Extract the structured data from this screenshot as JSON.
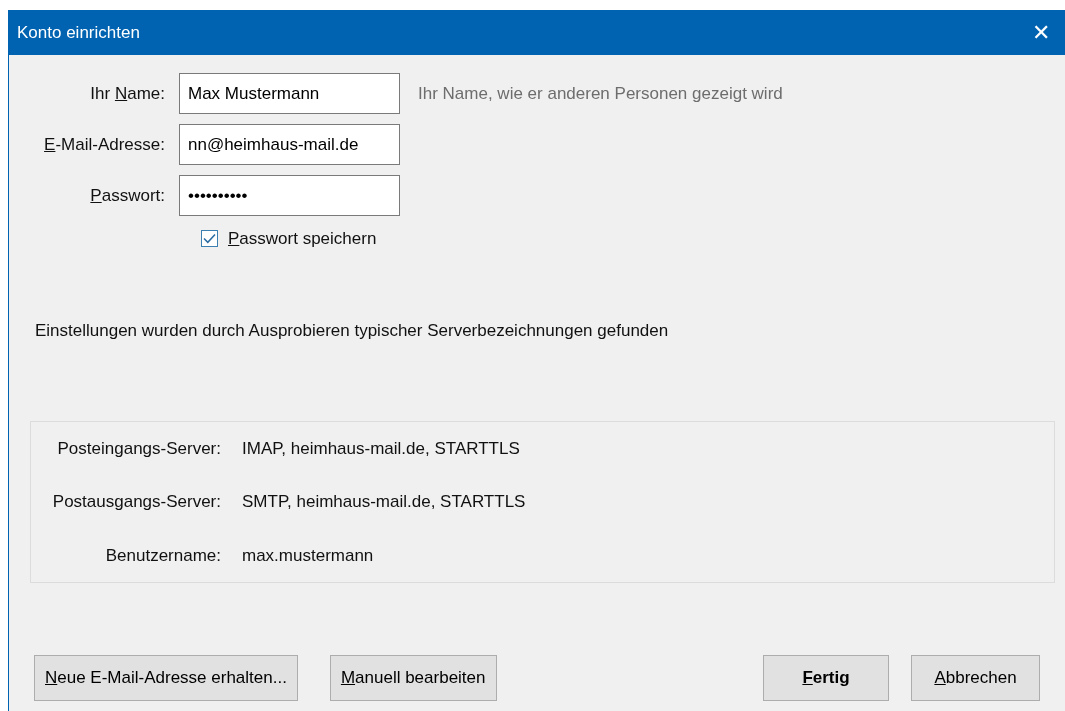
{
  "window": {
    "title": "Konto einrichten",
    "close": "✕"
  },
  "fields": [
    {
      "label": {
        "before": "Ihr ",
        "access_key": "N",
        "after": "ame:"
      },
      "value": "Max Mustermann",
      "hint": "Ihr Name, wie er anderen Personen gezeigt wird"
    },
    {
      "label": {
        "access_key": "E",
        "after": "-Mail-Adresse:"
      },
      "value": "nn@heimhaus-mail.de"
    },
    {
      "label": {
        "access_key": "P",
        "after": "asswort:"
      },
      "value": "••••••••••"
    }
  ],
  "remember_password": {
    "label": {
      "access_key": "P",
      "after": "asswort speichern"
    },
    "checked": true
  },
  "status_message": "Einstellungen wurden durch Ausprobieren typischer Serverbezeichnungen gefunden",
  "server_settings": [
    {
      "label": "Posteingangs-Server:",
      "value": "IMAP, heimhaus-mail.de, STARTTLS"
    },
    {
      "label": "Postausgangs-Server:",
      "value": "SMTP, heimhaus-mail.de, STARTTLS"
    },
    {
      "label": "Benutzername:",
      "value": "max.mustermann"
    }
  ],
  "buttons_left": [
    {
      "label": {
        "access_key": "N",
        "after": "eue E-Mail-Adresse erhalten..."
      },
      "default": false
    },
    {
      "label": {
        "access_key": "M",
        "after": "anuell bearbeiten"
      },
      "default": false
    }
  ],
  "buttons_right": [
    {
      "label": {
        "access_key": "F",
        "after": "ertig"
      },
      "default": true
    },
    {
      "label": {
        "access_key": "A",
        "after": "bbrechen"
      },
      "default": false
    }
  ]
}
